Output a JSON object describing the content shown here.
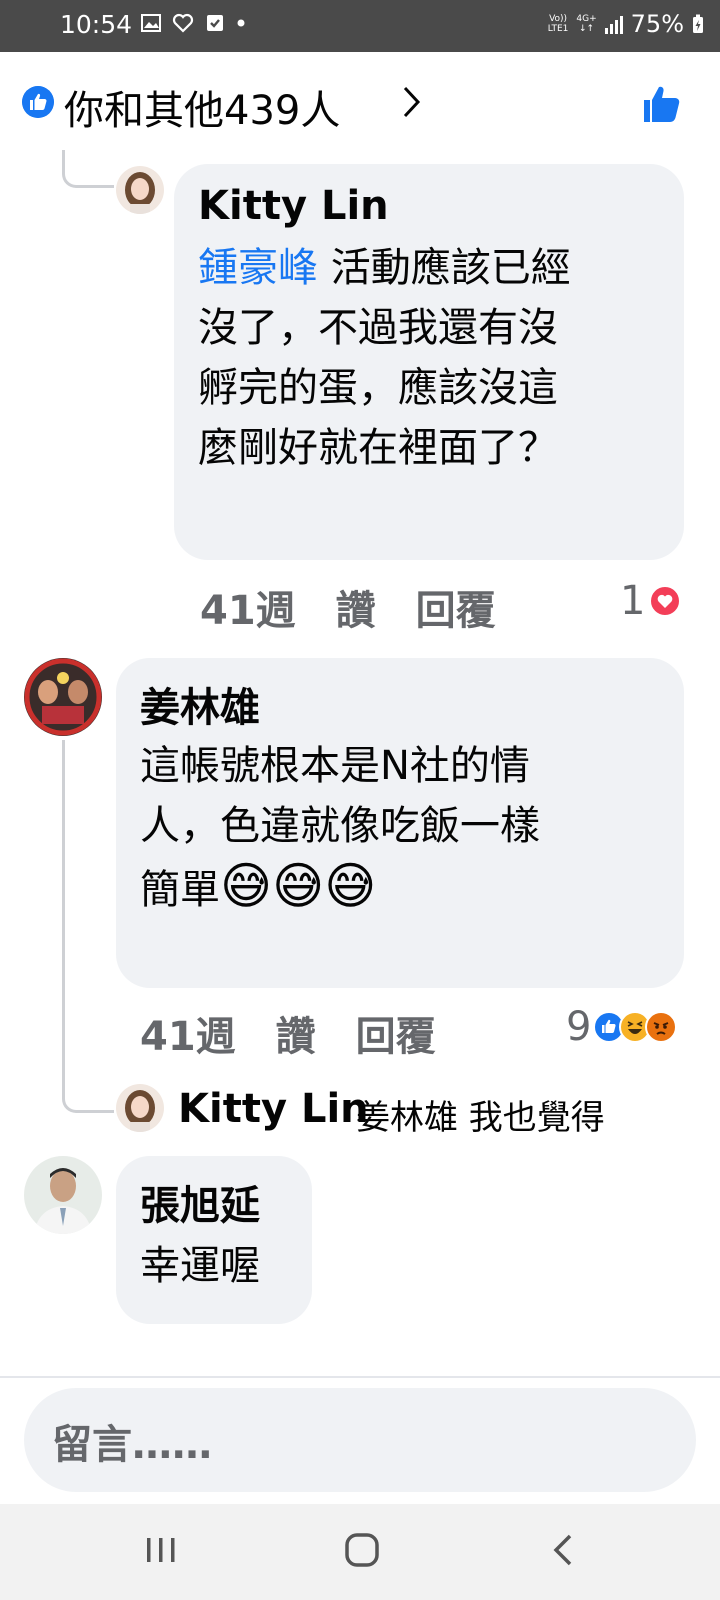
{
  "status_bar": {
    "time": "10:54",
    "network_top": "Vo))",
    "network_bottom": "LTE1",
    "data_top": "4G+",
    "battery": "75%"
  },
  "likes": {
    "text": "你和其他439人",
    "chevron": "›"
  },
  "comments": [
    {
      "name": "Kitty Lin",
      "mention": "鍾豪峰",
      "lines": [
        "活動應該已經",
        "沒了，不過我還有沒",
        "孵完的蛋，應該沒這",
        "麼剛好就在裡面了？"
      ],
      "time": "41週",
      "like_label": "讚",
      "reply_label": "回覆",
      "reaction_count": "1"
    },
    {
      "name": "姜林雄",
      "lines": [
        "這帳號根本是N社的情",
        "人，色違就像吃飯一樣",
        "簡單"
      ],
      "emojis": "😅😅😅",
      "time": "41週",
      "like_label": "讚",
      "reply_label": "回覆",
      "reaction_count": "9"
    },
    {
      "name": "張旭延",
      "lines": [
        "幸運喔"
      ]
    }
  ],
  "reply_preview": {
    "name": "Kitty Lin",
    "text": "姜林雄 我也覺得"
  },
  "comment_input": {
    "placeholder": "留言……"
  },
  "colors": {
    "brand_blue": "#1877f2",
    "bubble_bg": "#f0f2f5",
    "meta_gray": "#65676b",
    "love_red": "#f33e58"
  }
}
